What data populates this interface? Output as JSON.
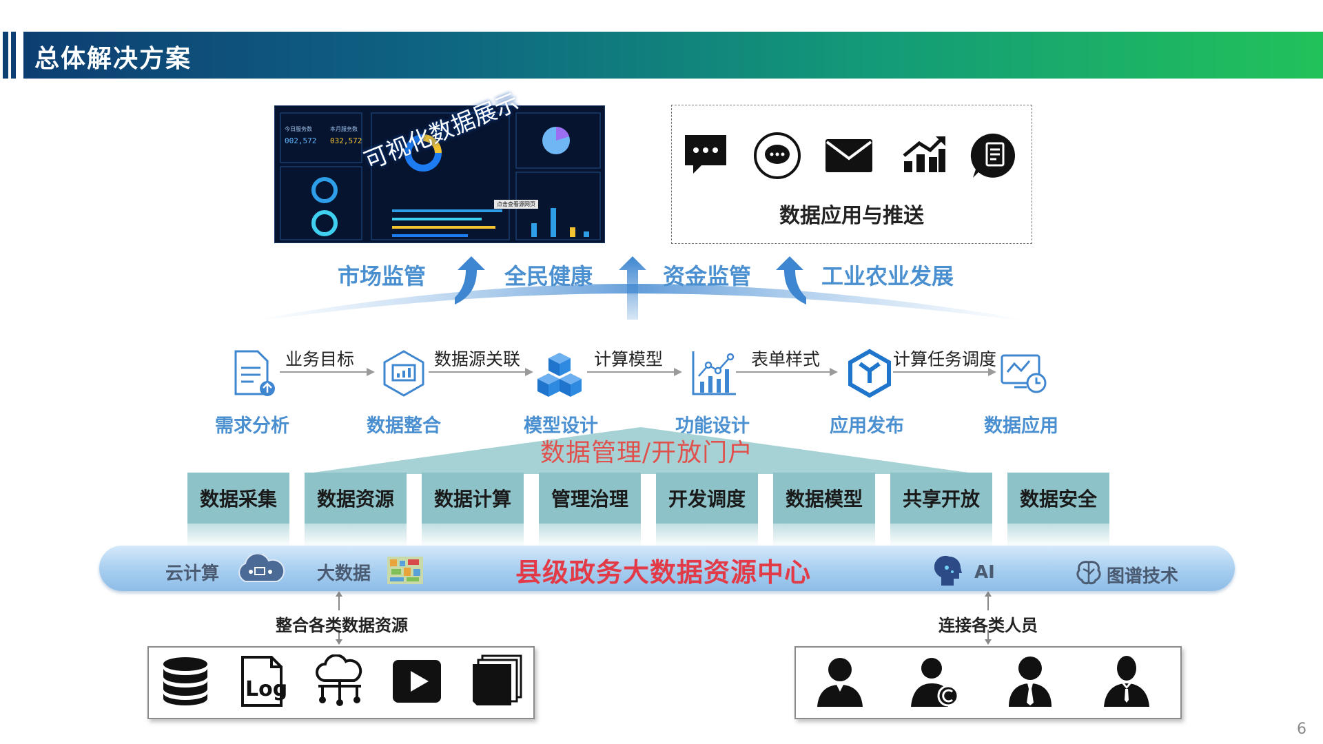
{
  "header": {
    "title": "总体解决方案"
  },
  "dashboard": {
    "overlay_text": "可视化数据展示",
    "stats": [
      {
        "label": "今日服务数",
        "value": "002,572"
      },
      {
        "label": "本月服务数",
        "value": "032,572"
      }
    ],
    "tooltip": "点击查看源网页"
  },
  "push": {
    "title": "数据应用与推送",
    "icons": [
      "chat-bubble-icon",
      "chat-round-icon",
      "mail-icon",
      "trend-chart-icon",
      "document-bubble-icon"
    ]
  },
  "categories": [
    "市场监管",
    "全民健康",
    "资金监管",
    "工业农业发展"
  ],
  "process": {
    "steps": [
      "需求分析",
      "数据整合",
      "模型设计",
      "功能设计",
      "应用发布",
      "数据应用"
    ],
    "arrows": [
      "业务目标",
      "数据源关联",
      "计算模型",
      "表单样式",
      "计算任务调度"
    ]
  },
  "portal_title": "数据管理/开放门户",
  "pillars": [
    "数据采集",
    "数据资源",
    "数据计算",
    "管理治理",
    "开发调度",
    "数据模型",
    "共享开放",
    "数据安全"
  ],
  "center": {
    "title": "县级政务大数据资源中心",
    "cloud": "云计算",
    "bigdata": "大数据",
    "ai": "AI",
    "graph": "图谱技术"
  },
  "sources": {
    "label": "整合各类数据资源",
    "icons": [
      "database-icon",
      "log-file-icon",
      "cloud-network-icon",
      "video-play-icon",
      "file-stack-icon"
    ]
  },
  "users": {
    "label": "连接各类人员",
    "icons": [
      "user-icon",
      "user-service-icon",
      "user-tie-icon",
      "user-manager-icon"
    ]
  },
  "page_number": "6",
  "colors": {
    "accent_blue": "#4a8fd0",
    "red": "#e23b47",
    "pillar": "#8dc3c8",
    "header_start": "#0d3e72",
    "header_end": "#22c25a"
  }
}
